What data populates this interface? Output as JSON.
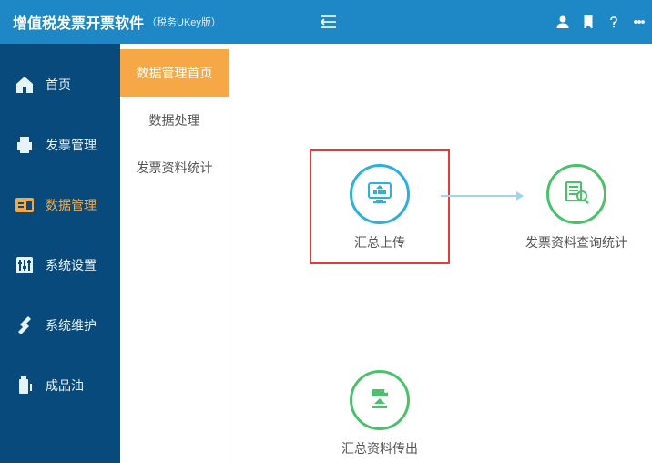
{
  "header": {
    "title": "增值税发票开票软件",
    "subtitle": "（税务UKey版）"
  },
  "nav": {
    "items": [
      {
        "id": "home",
        "label": "首页"
      },
      {
        "id": "invoice",
        "label": "发票管理"
      },
      {
        "id": "data",
        "label": "数据管理",
        "active": true
      },
      {
        "id": "settings",
        "label": "系统设置"
      },
      {
        "id": "maint",
        "label": "系统维护"
      },
      {
        "id": "oil",
        "label": "成品油"
      }
    ]
  },
  "subnav": {
    "items": [
      {
        "id": "data-home",
        "label": "数据管理首页",
        "active": true
      },
      {
        "id": "data-proc",
        "label": "数据处理"
      },
      {
        "id": "data-stats",
        "label": "发票资料统计"
      }
    ]
  },
  "cards": {
    "upload": {
      "label": "汇总上传"
    },
    "query": {
      "label": "发票资料查询统计"
    },
    "export": {
      "label": "汇总资料传出"
    }
  }
}
